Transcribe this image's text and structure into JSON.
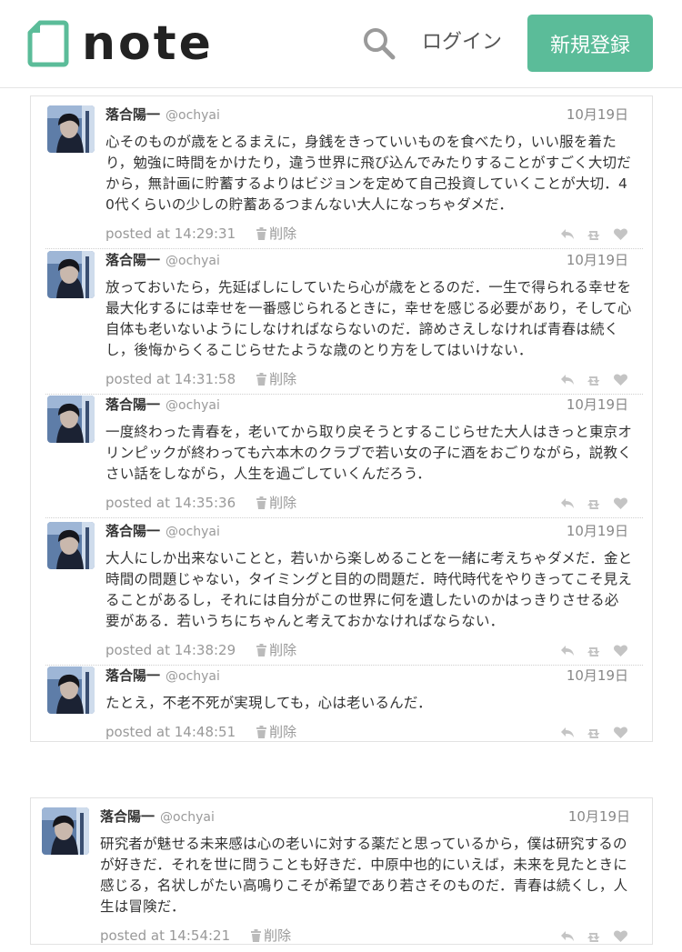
{
  "header": {
    "logo_text": "note",
    "login_label": "ログイン",
    "signup_label": "新規登録"
  },
  "colors": {
    "brand": "#5bbc99"
  },
  "icons": [
    "note-logo-icon",
    "search-icon",
    "trash-icon",
    "reply-icon",
    "retweet-icon",
    "heart-icon"
  ],
  "posts": [
    {
      "author": "落合陽一",
      "handle": "@ochyai",
      "date": "10月19日",
      "text": "心そのものが歳をとるまえに，身銭をきっていいものを食べたり，いい服を着たり，勉強に時間をかけたり，違う世界に飛び込んでみたりすることがすごく大切だから，無計画に貯蓄するよりはビジョンを定めて自己投資していくことが大切．40代くらいの少しの貯蓄あるつまんない大人になっちゃダメだ．",
      "posted": "posted at 14:29:31",
      "delete_label": "削除"
    },
    {
      "author": "落合陽一",
      "handle": "@ochyai",
      "date": "10月19日",
      "text": "放っておいたら，先延ばしにしていたら心が歳をとるのだ．一生で得られる幸せを最大化するには幸せを一番感じられるときに，幸せを感じる必要があり，そして心自体も老いないようにしなければならないのだ．諦めさえしなければ青春は続くし，後悔からくるこじらせたような歳のとり方をしてはいけない．",
      "posted": "posted at 14:31:58",
      "delete_label": "削除"
    },
    {
      "author": "落合陽一",
      "handle": "@ochyai",
      "date": "10月19日",
      "text": "一度終わった青春を，老いてから取り戻そうとするこじらせた大人はきっと東京オリンピックが終わっても六本木のクラブで若い女の子に酒をおごりながら，説教くさい話をしながら，人生を過ごしていくんだろう．",
      "posted": "posted at 14:35:36",
      "delete_label": "削除"
    },
    {
      "author": "落合陽一",
      "handle": "@ochyai",
      "date": "10月19日",
      "text": "大人にしか出来ないことと，若いから楽しめることを一緒に考えちゃダメだ．金と時間の問題じゃない，タイミングと目的の問題だ．時代時代をやりきってこそ見えることがあるし，それには自分がこの世界に何を遺したいのかはっきりさせる必要がある．若いうちにちゃんと考えておかなければならない．",
      "posted": "posted at 14:38:29",
      "delete_label": "削除"
    },
    {
      "author": "落合陽一",
      "handle": "@ochyai",
      "date": "10月19日",
      "text": "たとえ，不老不死が実現しても，心は老いるんだ．",
      "posted": "posted at 14:48:51",
      "delete_label": "削除"
    },
    {
      "author": "落合陽一",
      "handle": "@ochyai",
      "date": "10月19日",
      "text": "研究者が魅せる未来感は心の老いに対する薬だと思っているから，僕は研究するのが好きだ．それを世に問うことも好きだ．中原中也的にいえば，未来を見たときに感じる，名状しがたい高鳴りこそが希望であり若さそのものだ．青春は続くし，人生は冒険だ．",
      "posted": "posted at 14:54:21",
      "delete_label": "削除"
    }
  ]
}
